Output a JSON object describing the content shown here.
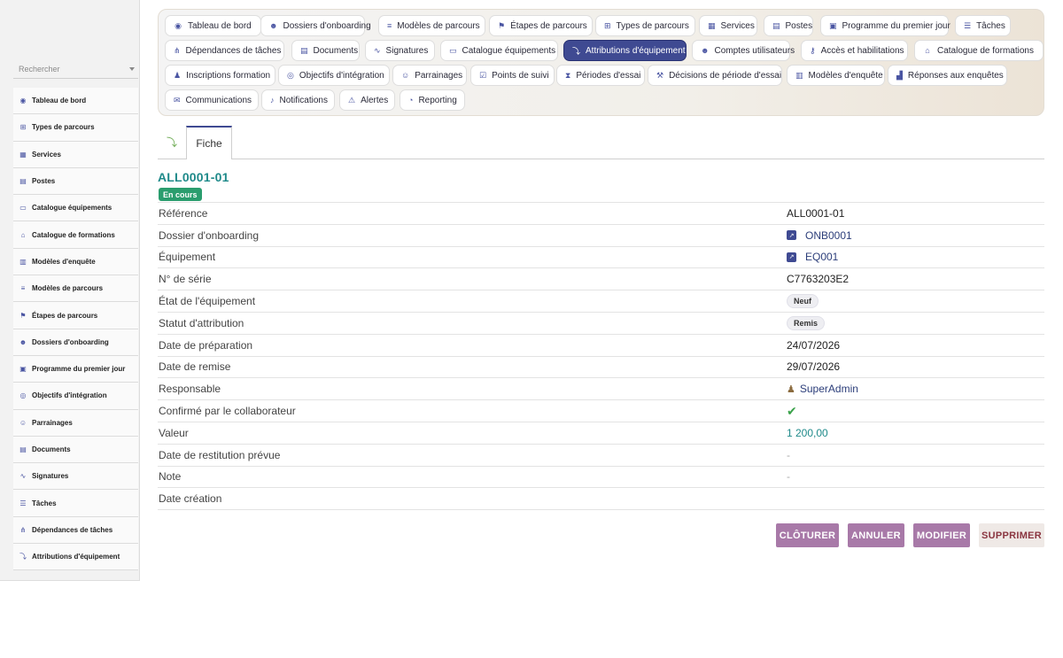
{
  "sidebar": {
    "search_placeholder": "Rechercher",
    "items": [
      {
        "label": "Tableau de bord",
        "icon": "dashboard-icon",
        "glyph": "◉"
      },
      {
        "label": "Types de parcours",
        "icon": "sitemap-icon",
        "glyph": "⊞"
      },
      {
        "label": "Services",
        "icon": "building-icon",
        "glyph": "▦"
      },
      {
        "label": "Postes",
        "icon": "id-card-icon",
        "glyph": "▤"
      },
      {
        "label": "Catalogue équipements",
        "icon": "laptop-icon",
        "glyph": "▭"
      },
      {
        "label": "Catalogue de formations",
        "icon": "graduation-cap-icon",
        "glyph": "⌂"
      },
      {
        "label": "Modèles d'enquête",
        "icon": "clipboard-icon",
        "glyph": "▥"
      },
      {
        "label": "Modèles de parcours",
        "icon": "signs-icon",
        "glyph": "≡"
      },
      {
        "label": "Étapes de parcours",
        "icon": "flag-icon",
        "glyph": "⚑"
      },
      {
        "label": "Dossiers d'onboarding",
        "icon": "user-plus-icon",
        "glyph": "☻"
      },
      {
        "label": "Programme du premier jour",
        "icon": "calendar-icon",
        "glyph": "▣"
      },
      {
        "label": "Objectifs d'intégration",
        "icon": "target-icon",
        "glyph": "◎"
      },
      {
        "label": "Parrainages",
        "icon": "users-icon",
        "glyph": "☺"
      },
      {
        "label": "Documents",
        "icon": "file-icon",
        "glyph": "▤"
      },
      {
        "label": "Signatures",
        "icon": "signature-icon",
        "glyph": "∿"
      },
      {
        "label": "Tâches",
        "icon": "list-icon",
        "glyph": "☰"
      },
      {
        "label": "Dépendances de tâches",
        "icon": "diagram-icon",
        "glyph": "⋔"
      },
      {
        "label": "Attributions d'équipement",
        "icon": "dolly-icon",
        "glyph": "⤵"
      }
    ]
  },
  "topnav": {
    "items": [
      {
        "label": "Tableau de bord",
        "icon": "dashboard-icon",
        "glyph": "◉",
        "active": false
      },
      {
        "label": "Dossiers d'onboarding",
        "icon": "user-plus-icon",
        "glyph": "☻",
        "active": false
      },
      {
        "label": "Modèles de parcours",
        "icon": "signs-icon",
        "glyph": "≡",
        "active": false
      },
      {
        "label": "Étapes de parcours",
        "icon": "flag-icon",
        "glyph": "⚑",
        "active": false
      },
      {
        "label": "Types de parcours",
        "icon": "sitemap-icon",
        "glyph": "⊞",
        "active": false
      },
      {
        "label": "Services",
        "icon": "building-icon",
        "glyph": "▦",
        "active": false
      },
      {
        "label": "Postes",
        "icon": "id-card-icon",
        "glyph": "▤",
        "active": false
      },
      {
        "label": "Programme du premier jour",
        "icon": "calendar-icon",
        "glyph": "▣",
        "active": false
      },
      {
        "label": "Tâches",
        "icon": "list-icon",
        "glyph": "☰",
        "active": false
      },
      {
        "label": "Dépendances de tâches",
        "icon": "diagram-icon",
        "glyph": "⋔",
        "active": false
      },
      {
        "label": "Documents",
        "icon": "file-icon",
        "glyph": "▤",
        "active": false
      },
      {
        "label": "Signatures",
        "icon": "signature-icon",
        "glyph": "∿",
        "active": false
      },
      {
        "label": "Catalogue équipements",
        "icon": "laptop-icon",
        "glyph": "▭",
        "active": false
      },
      {
        "label": "Attributions d'équipement",
        "icon": "dolly-icon",
        "glyph": "⤵",
        "active": true
      },
      {
        "label": "Comptes utilisateurs",
        "icon": "user-cog-icon",
        "glyph": "☻",
        "active": false
      },
      {
        "label": "Accès et habilitations",
        "icon": "key-icon",
        "glyph": "⚷",
        "active": false
      },
      {
        "label": "Catalogue de formations",
        "icon": "graduation-cap-icon",
        "glyph": "⌂",
        "active": false
      },
      {
        "label": "Inscriptions formation",
        "icon": "user-tie-icon",
        "glyph": "♟",
        "active": false
      },
      {
        "label": "Objectifs d'intégration",
        "icon": "target-icon",
        "glyph": "◎",
        "active": false
      },
      {
        "label": "Parrainages",
        "icon": "users-icon",
        "glyph": "☺",
        "active": false
      },
      {
        "label": "Points de suivi",
        "icon": "check-square-icon",
        "glyph": "☑",
        "active": false
      },
      {
        "label": "Périodes d'essai",
        "icon": "hourglass-icon",
        "glyph": "⧗",
        "active": false
      },
      {
        "label": "Décisions de période d'essai",
        "icon": "gavel-icon",
        "glyph": "⚒",
        "active": false
      },
      {
        "label": "Modèles d'enquête",
        "icon": "clipboard-icon",
        "glyph": "▥",
        "active": false
      },
      {
        "label": "Réponses aux enquêtes",
        "icon": "chart-icon",
        "glyph": "▟",
        "active": false
      },
      {
        "label": "Communications",
        "icon": "envelope-icon",
        "glyph": "✉",
        "active": false
      },
      {
        "label": "Notifications",
        "icon": "bell-icon",
        "glyph": "♪",
        "active": false
      },
      {
        "label": "Alertes",
        "icon": "warning-icon",
        "glyph": "⚠",
        "active": false
      },
      {
        "label": "Reporting",
        "icon": "pie-chart-icon",
        "glyph": "◔",
        "active": false
      }
    ]
  },
  "tabs": {
    "icon": "dolly-icon",
    "glyph": "⤵",
    "fiche_label": "Fiche"
  },
  "record": {
    "title": "ALL0001-01",
    "status": "En cours",
    "status_color": "#2a9d6e",
    "fields": [
      {
        "label": "Référence",
        "value": "ALL0001-01",
        "kind": "text"
      },
      {
        "label": "Dossier d'onboarding",
        "value": "ONB0001",
        "kind": "link"
      },
      {
        "label": "Équipement",
        "value": "EQ001",
        "kind": "link"
      },
      {
        "label": "N° de série",
        "value": "C7763203E2",
        "kind": "text"
      },
      {
        "label": "État de l'équipement",
        "value": "Neuf",
        "kind": "chip"
      },
      {
        "label": "Statut d'attribution",
        "value": "Remis",
        "kind": "chip"
      },
      {
        "label": "Date de préparation",
        "value": "24/07/2026",
        "kind": "text"
      },
      {
        "label": "Date de remise",
        "value": "29/07/2026",
        "kind": "text"
      },
      {
        "label": "Responsable",
        "value": "SuperAdmin",
        "kind": "user"
      },
      {
        "label": "Confirmé par le collaborateur",
        "value": "✔",
        "kind": "check"
      },
      {
        "label": "Valeur",
        "value": "1 200,00",
        "kind": "teal"
      },
      {
        "label": "Date de restitution prévue",
        "value": "-",
        "kind": "muted"
      },
      {
        "label": "Note",
        "value": "-",
        "kind": "muted"
      },
      {
        "label": "Date création",
        "value": "",
        "kind": "text"
      }
    ]
  },
  "actions": {
    "close_label": "CLÔTURER",
    "cancel_label": "ANNULER",
    "edit_label": "MODIFIER",
    "delete_label": "SUPPRIMER"
  },
  "colors": {
    "accent": "#3f4a92",
    "action": "#a879a8",
    "title": "#1f8a8a"
  }
}
